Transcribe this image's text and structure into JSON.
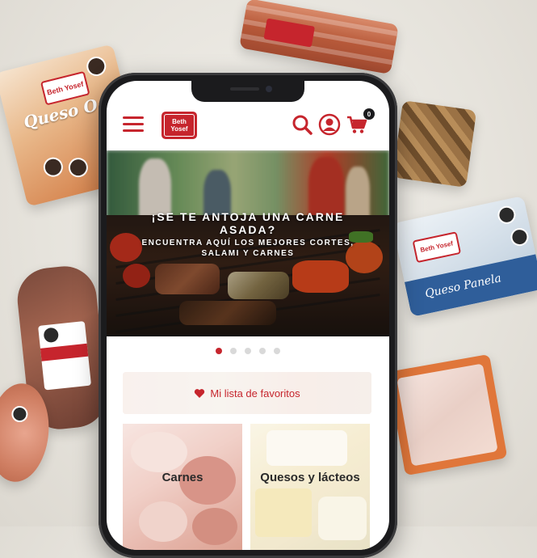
{
  "products": {
    "queso_left_name": "Queso O",
    "queso_left_brand": "Beth Yosef",
    "queso_panela_name": "Queso Panela",
    "queso_panela_brand": "Beth Yosef"
  },
  "header": {
    "brand_line1": "Beth",
    "brand_line2": "Yosef",
    "cart_count": "0"
  },
  "hero": {
    "title": "¡SE TE ANTOJA UNA CARNE ASADA?",
    "subtitle": "ENCUENTRA AQUÍ LOS MEJORES CORTES, SALAMI Y CARNES"
  },
  "carousel": {
    "slides": 5,
    "active": 1
  },
  "favorites": {
    "label": "Mi lista de favoritos"
  },
  "categories": [
    {
      "label": "Carnes"
    },
    {
      "label": "Quesos y lácteos"
    }
  ],
  "colors": {
    "brand_red": "#c6252d"
  },
  "icons": [
    "menu-icon",
    "search-icon",
    "account-icon",
    "cart-icon",
    "heart-icon"
  ]
}
